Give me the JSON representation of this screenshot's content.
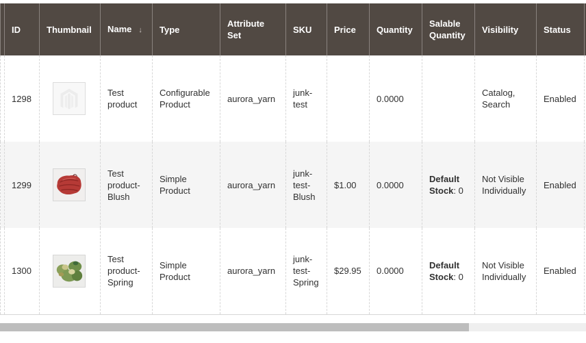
{
  "grid": {
    "columns": [
      {
        "key": "id",
        "label": "ID"
      },
      {
        "key": "thumbnail",
        "label": "Thumbnail"
      },
      {
        "key": "name",
        "label": "Name",
        "sort_indicator": "↓"
      },
      {
        "key": "type",
        "label": "Type"
      },
      {
        "key": "attribute_set",
        "label": "Attribute Set"
      },
      {
        "key": "sku",
        "label": "SKU"
      },
      {
        "key": "price",
        "label": "Price"
      },
      {
        "key": "quantity",
        "label": "Quantity"
      },
      {
        "key": "salable_quantity",
        "label": "Salable Quantity"
      },
      {
        "key": "visibility",
        "label": "Visibility"
      },
      {
        "key": "status",
        "label": "Status"
      }
    ],
    "rows": [
      {
        "id": "1298",
        "thumbnail": "placeholder-logo-icon",
        "name": "Test product",
        "type": "Configurable Product",
        "attribute_set": "aurora_yarn",
        "sku": "junk-test",
        "price": "",
        "quantity": "0.0000",
        "salable_label": "",
        "salable_value": "",
        "visibility": "Catalog, Search",
        "status": "Enabled"
      },
      {
        "id": "1299",
        "thumbnail": "red-yarn-image",
        "name": "Test product-Blush",
        "type": "Simple Product",
        "attribute_set": "aurora_yarn",
        "sku": "junk-test-Blush",
        "price": "$1.00",
        "quantity": "0.0000",
        "salable_label": "Default Stock",
        "salable_value": ": 0",
        "visibility": "Not Visible Individually",
        "status": "Enabled"
      },
      {
        "id": "1300",
        "thumbnail": "green-yarn-image",
        "name": "Test product-Spring",
        "type": "Simple Product",
        "attribute_set": "aurora_yarn",
        "sku": "junk-test-Spring",
        "price": "$29.95",
        "quantity": "0.0000",
        "salable_label": "Default Stock",
        "salable_value": ": 0",
        "visibility": "Not Visible Individually",
        "status": "Enabled"
      }
    ]
  },
  "scrollbar": {
    "thumb_fraction": 0.8
  },
  "colors": {
    "header_bg": "#514943",
    "header_text": "#ffffff",
    "row_alt_bg": "#f5f5f5",
    "scroll_track": "#efefef",
    "scroll_thumb": "#bdbdbd"
  }
}
